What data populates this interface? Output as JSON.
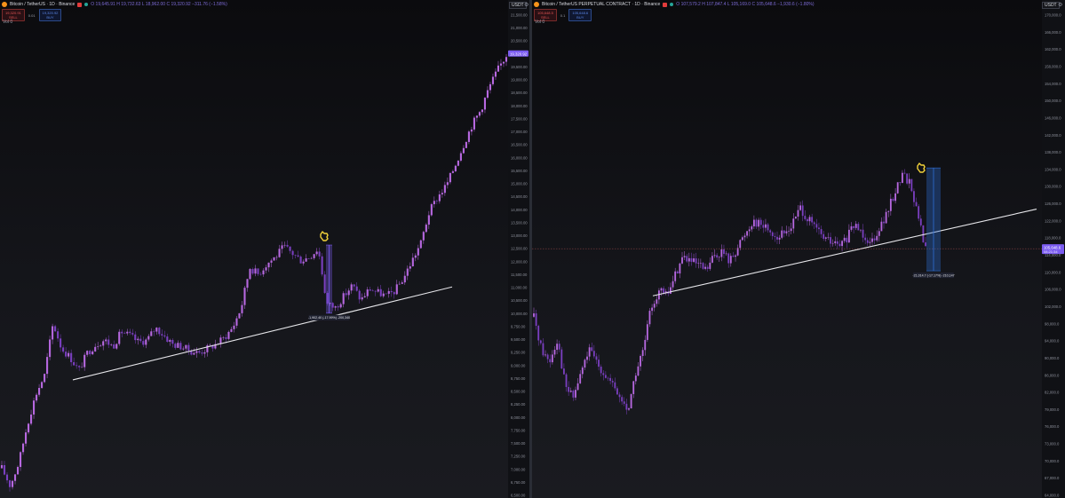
{
  "panes": [
    {
      "id": "left",
      "title": "Bitcoin / TetherUS · 1D · Binance",
      "ohlc": "O 19,645.91 H 19,732.63 L 18,962.00 C 19,320.92 −311.76 (−1.58%)",
      "sell_price": "19,320.91",
      "sell_label": "SELL",
      "spread": "0.01",
      "buy_price": "19,320.92",
      "buy_label": "BUY",
      "indicator": "Vol 0",
      "currency": "USDT",
      "current_price_label": "19,320.92",
      "measure_label": "-1,902.40 (-17.99%) -200,340",
      "axis_ticks": [
        "21,500.00",
        "21,000.00",
        "20,500.00",
        "20,000.00",
        "19,500.00",
        "19,000.00",
        "18,500.00",
        "18,000.00",
        "17,500.00",
        "17,000.00",
        "16,500.00",
        "16,000.00",
        "15,500.00",
        "15,000.00",
        "14,500.00",
        "14,000.00",
        "13,500.00",
        "13,000.00",
        "12,500.00",
        "12,000.00",
        "11,500.00",
        "11,000.00",
        "10,500.00",
        "10,000.00",
        "9,750.00",
        "9,500.00",
        "9,250.00",
        "9,000.00",
        "8,750.00",
        "8,500.00",
        "8,250.00",
        "8,000.00",
        "7,750.00",
        "7,500.00",
        "7,250.00",
        "7,000.00",
        "6,750.00",
        "6,500.00"
      ]
    },
    {
      "id": "right",
      "title": "Bitcoin / TetherUS PERPETUAL CONTRACT · 1D · Binance",
      "ohlc": "O 107,579.2 H 107,847.4 L 105,169.0 C 105,648.6 −1,930.6 (−1.80%)",
      "sell_price": "105,648.5",
      "sell_label": "SELL",
      "spread": "0.1",
      "buy_price": "105,648.6",
      "buy_label": "BUY",
      "indicator": "Vol 0",
      "currency": "USDT",
      "current_price_label": "105,648.6",
      "current_price_sub": "08:21:34",
      "measure_label": "-21,014.7 (-17.17%) -210,147",
      "axis_ticks": [
        "170,000.0",
        "166,000.0",
        "162,000.0",
        "158,000.0",
        "154,000.0",
        "150,000.0",
        "146,000.0",
        "142,000.0",
        "138,000.0",
        "134,000.0",
        "130,000.0",
        "126,000.0",
        "122,000.0",
        "118,000.0",
        "114,000.0",
        "110,000.0",
        "106,000.0",
        "102,000.0",
        "98,000.0",
        "94,000.0",
        "90,000.0",
        "86,000.0",
        "82,000.0",
        "79,000.0",
        "76,000.0",
        "73,000.0",
        "70,000.0",
        "67,000.0",
        "64,000.0"
      ]
    }
  ],
  "chart_data": [
    {
      "type": "candlestick",
      "title": "Bitcoin / TetherUS · 1D · Binance",
      "xlabel": "",
      "ylabel": "",
      "ylim": [
        6350,
        21700
      ],
      "y_scale": "log",
      "series": [
        {
          "close_path": [
            6800,
            6500,
            6900,
            7600,
            8200,
            8600,
            9800,
            9200,
            9000,
            8700,
            9100,
            9300,
            9400,
            9250,
            9600,
            9500,
            9350,
            9400,
            9700,
            9500,
            9300,
            9250,
            9150,
            9100,
            9200,
            9300,
            9450,
            9700,
            10200,
            11300,
            11100,
            11400,
            11600,
            11900,
            11700,
            11500,
            11600,
            11850,
            10300,
            10200,
            10500,
            10800,
            10400,
            10700,
            10600,
            10500,
            10650,
            11000,
            11500,
            12000,
            13000,
            13500,
            13900,
            14600,
            15400,
            16200,
            16800,
            17800,
            18600,
            19320
          ],
          "trendline_start": 8500,
          "trendline_end": 10750
        }
      ],
      "annotations": {
        "measure": {
          "from": 11950,
          "to": 10060,
          "label": "-1,902.40 (-17.99%) -200,340"
        },
        "current_price": 19320.92
      },
      "colors": {
        "candles": "#9a4fd6",
        "trendline": "#e6e6ea",
        "measure": "#7b5cf0",
        "hand": "#f2d23a"
      }
    },
    {
      "type": "candlestick",
      "title": "Bitcoin / TetherUS PERPETUAL CONTRACT · 1D · Binance",
      "xlabel": "",
      "ylabel": "",
      "ylim": [
        64000,
        172000
      ],
      "y_scale": "log",
      "series": [
        {
          "close_path": [
            92000,
            86000,
            84000,
            88000,
            80000,
            78000,
            82000,
            86000,
            84000,
            82000,
            80000,
            78000,
            76000,
            82000,
            86000,
            94000,
            97000,
            96000,
            100000,
            104000,
            103000,
            102000,
            101000,
            104000,
            105000,
            103000,
            106000,
            109000,
            112000,
            111000,
            110000,
            108000,
            109000,
            111000,
            115000,
            112000,
            110000,
            108000,
            107000,
            106000,
            108000,
            111000,
            109000,
            107000,
            110000,
            113000,
            118000,
            123000,
            121000,
            113000,
            105648
          ],
          "trendline_start": 96000,
          "trendline_end": 114500
        }
      ],
      "annotations": {
        "measure": {
          "from": 124500,
          "to": 101000,
          "label": "-21,014.7 (-17.17%) -210,147"
        },
        "current_price": 105648.6
      },
      "colors": {
        "candles": "#9a4fd6",
        "trendline": "#e6e6ea",
        "measure": "#2f6fd6",
        "hand": "#f2d23a"
      }
    }
  ]
}
